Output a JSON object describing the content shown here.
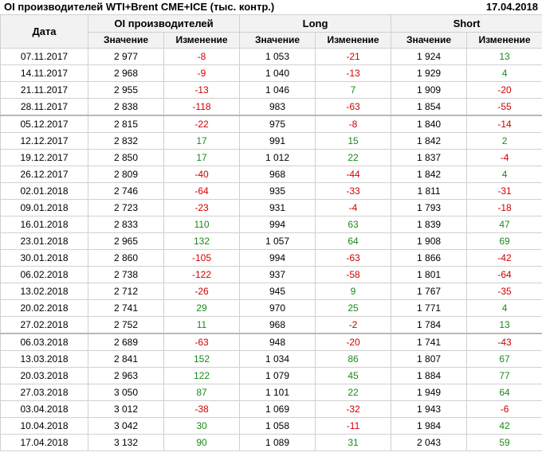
{
  "header": {
    "title": "OI производителей WTI+Brent CME+ICE (тыс. контр.)",
    "date": "17.04.2018"
  },
  "columns": {
    "date": "Дата",
    "group_oi": "OI производителей",
    "group_long": "Long",
    "group_short": "Short",
    "value": "Значение",
    "change": "Изменение"
  },
  "colors": {
    "negative": "#d00000",
    "positive": "#1a8a1a"
  },
  "rows": [
    {
      "date": "07.11.2017",
      "oi": "2 977",
      "oi_chg": "-8",
      "long": "1 053",
      "long_chg": "-21",
      "short": "1 924",
      "short_chg": "13"
    },
    {
      "date": "14.11.2017",
      "oi": "2 968",
      "oi_chg": "-9",
      "long": "1 040",
      "long_chg": "-13",
      "short": "1 929",
      "short_chg": "4"
    },
    {
      "date": "21.11.2017",
      "oi": "2 955",
      "oi_chg": "-13",
      "long": "1 046",
      "long_chg": "7",
      "short": "1 909",
      "short_chg": "-20"
    },
    {
      "date": "28.11.2017",
      "oi": "2 838",
      "oi_chg": "-118",
      "long": "983",
      "long_chg": "-63",
      "short": "1 854",
      "short_chg": "-55"
    },
    {
      "date": "05.12.2017",
      "oi": "2 815",
      "oi_chg": "-22",
      "long": "975",
      "long_chg": "-8",
      "short": "1 840",
      "short_chg": "-14",
      "month_start": true
    },
    {
      "date": "12.12.2017",
      "oi": "2 832",
      "oi_chg": "17",
      "long": "991",
      "long_chg": "15",
      "short": "1 842",
      "short_chg": "2"
    },
    {
      "date": "19.12.2017",
      "oi": "2 850",
      "oi_chg": "17",
      "long": "1 012",
      "long_chg": "22",
      "short": "1 837",
      "short_chg": "-4"
    },
    {
      "date": "26.12.2017",
      "oi": "2 809",
      "oi_chg": "-40",
      "long": "968",
      "long_chg": "-44",
      "short": "1 842",
      "short_chg": "4"
    },
    {
      "date": "02.01.2018",
      "oi": "2 746",
      "oi_chg": "-64",
      "long": "935",
      "long_chg": "-33",
      "short": "1 811",
      "short_chg": "-31"
    },
    {
      "date": "09.01.2018",
      "oi": "2 723",
      "oi_chg": "-23",
      "long": "931",
      "long_chg": "-4",
      "short": "1 793",
      "short_chg": "-18"
    },
    {
      "date": "16.01.2018",
      "oi": "2 833",
      "oi_chg": "110",
      "long": "994",
      "long_chg": "63",
      "short": "1 839",
      "short_chg": "47"
    },
    {
      "date": "23.01.2018",
      "oi": "2 965",
      "oi_chg": "132",
      "long": "1 057",
      "long_chg": "64",
      "short": "1 908",
      "short_chg": "69"
    },
    {
      "date": "30.01.2018",
      "oi": "2 860",
      "oi_chg": "-105",
      "long": "994",
      "long_chg": "-63",
      "short": "1 866",
      "short_chg": "-42"
    },
    {
      "date": "06.02.2018",
      "oi": "2 738",
      "oi_chg": "-122",
      "long": "937",
      "long_chg": "-58",
      "short": "1 801",
      "short_chg": "-64"
    },
    {
      "date": "13.02.2018",
      "oi": "2 712",
      "oi_chg": "-26",
      "long": "945",
      "long_chg": "9",
      "short": "1 767",
      "short_chg": "-35"
    },
    {
      "date": "20.02.2018",
      "oi": "2 741",
      "oi_chg": "29",
      "long": "970",
      "long_chg": "25",
      "short": "1 771",
      "short_chg": "4"
    },
    {
      "date": "27.02.2018",
      "oi": "2 752",
      "oi_chg": "11",
      "long": "968",
      "long_chg": "-2",
      "short": "1 784",
      "short_chg": "13"
    },
    {
      "date": "06.03.2018",
      "oi": "2 689",
      "oi_chg": "-63",
      "long": "948",
      "long_chg": "-20",
      "short": "1 741",
      "short_chg": "-43",
      "month_start": true
    },
    {
      "date": "13.03.2018",
      "oi": "2 841",
      "oi_chg": "152",
      "long": "1 034",
      "long_chg": "86",
      "short": "1 807",
      "short_chg": "67"
    },
    {
      "date": "20.03.2018",
      "oi": "2 963",
      "oi_chg": "122",
      "long": "1 079",
      "long_chg": "45",
      "short": "1 884",
      "short_chg": "77"
    },
    {
      "date": "27.03.2018",
      "oi": "3 050",
      "oi_chg": "87",
      "long": "1 101",
      "long_chg": "22",
      "short": "1 949",
      "short_chg": "64"
    },
    {
      "date": "03.04.2018",
      "oi": "3 012",
      "oi_chg": "-38",
      "long": "1 069",
      "long_chg": "-32",
      "short": "1 943",
      "short_chg": "-6"
    },
    {
      "date": "10.04.2018",
      "oi": "3 042",
      "oi_chg": "30",
      "long": "1 058",
      "long_chg": "-11",
      "short": "1 984",
      "short_chg": "42"
    },
    {
      "date": "17.04.2018",
      "oi": "3 132",
      "oi_chg": "90",
      "long": "1 089",
      "long_chg": "31",
      "short": "2 043",
      "short_chg": "59"
    }
  ]
}
